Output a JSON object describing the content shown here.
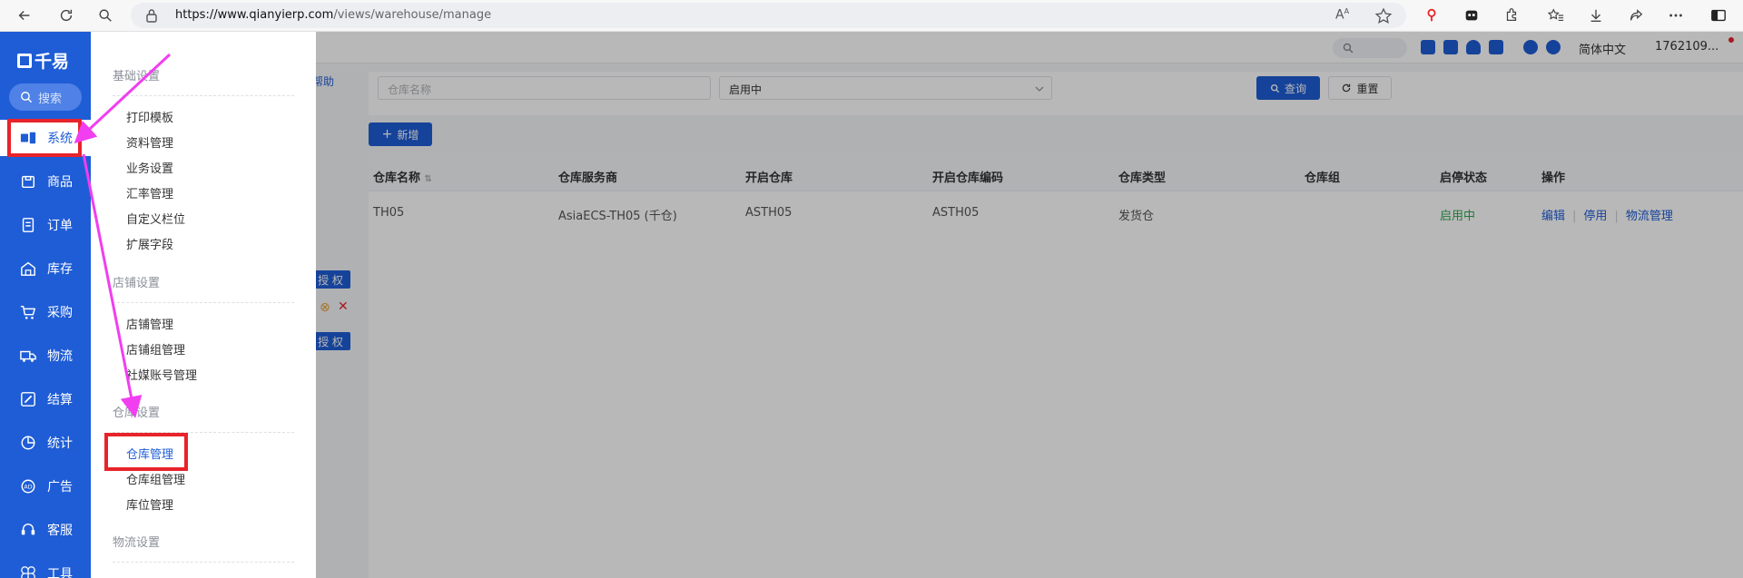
{
  "browser": {
    "url_host": "https://www.qianyierp.com",
    "url_path": "/views/warehouse/manage"
  },
  "sidebar": {
    "logo": "千易",
    "search_label": "搜索",
    "items": [
      {
        "label": "系统",
        "icon": "system-icon"
      },
      {
        "label": "商品",
        "icon": "goods-icon"
      },
      {
        "label": "订单",
        "icon": "order-icon"
      },
      {
        "label": "库存",
        "icon": "inventory-icon"
      },
      {
        "label": "采购",
        "icon": "cart-icon"
      },
      {
        "label": "物流",
        "icon": "truck-icon"
      },
      {
        "label": "结算",
        "icon": "settlement-icon"
      },
      {
        "label": "统计",
        "icon": "pie-chart-icon"
      },
      {
        "label": "广告",
        "icon": "ad-icon"
      },
      {
        "label": "客服",
        "icon": "support-icon"
      },
      {
        "label": "工具",
        "icon": "tools-icon"
      }
    ]
  },
  "flyout": {
    "groups": [
      {
        "title": "基础设置",
        "items": [
          "打印模板",
          "资料管理",
          "业务设置",
          "汇率管理",
          "自定义栏位",
          "扩展字段"
        ]
      },
      {
        "title": "店铺设置",
        "items": [
          "店铺管理",
          "店铺组管理",
          "社媒账号管理"
        ]
      },
      {
        "title": "仓库设置",
        "items": [
          "仓库管理",
          "仓库组管理",
          "库位管理"
        ]
      },
      {
        "title": "物流设置",
        "items": []
      }
    ]
  },
  "topbar": {
    "language": "简体中文",
    "user": "1762109..."
  },
  "filters": {
    "help_link": "帮助",
    "name_placeholder": "仓库名称",
    "status_value": "启用中",
    "search_button": "查询",
    "reset_button": "重置",
    "add_button": "新增"
  },
  "side_buttons": {
    "auth_1": "授 权",
    "auth_2": "授 权"
  },
  "table": {
    "columns": [
      "仓库名称",
      "仓库服务商",
      "开启仓库",
      "开启仓库编码",
      "仓库类型",
      "仓库组",
      "启停状态",
      "操作"
    ],
    "rows": [
      {
        "name": "TH05",
        "provider": "AsiaECS-TH05 (千仓)",
        "warehouse": "ASTH05",
        "code": "ASTH05",
        "type": "发货仓",
        "group": "",
        "status": "启用中",
        "actions": [
          "编辑",
          "停用",
          "物流管理"
        ]
      }
    ]
  },
  "colors": {
    "brand": "#1f5dd6",
    "highlight": "#e8232a",
    "arrow": "#f13ef0",
    "status_green": "#2fa84f"
  }
}
